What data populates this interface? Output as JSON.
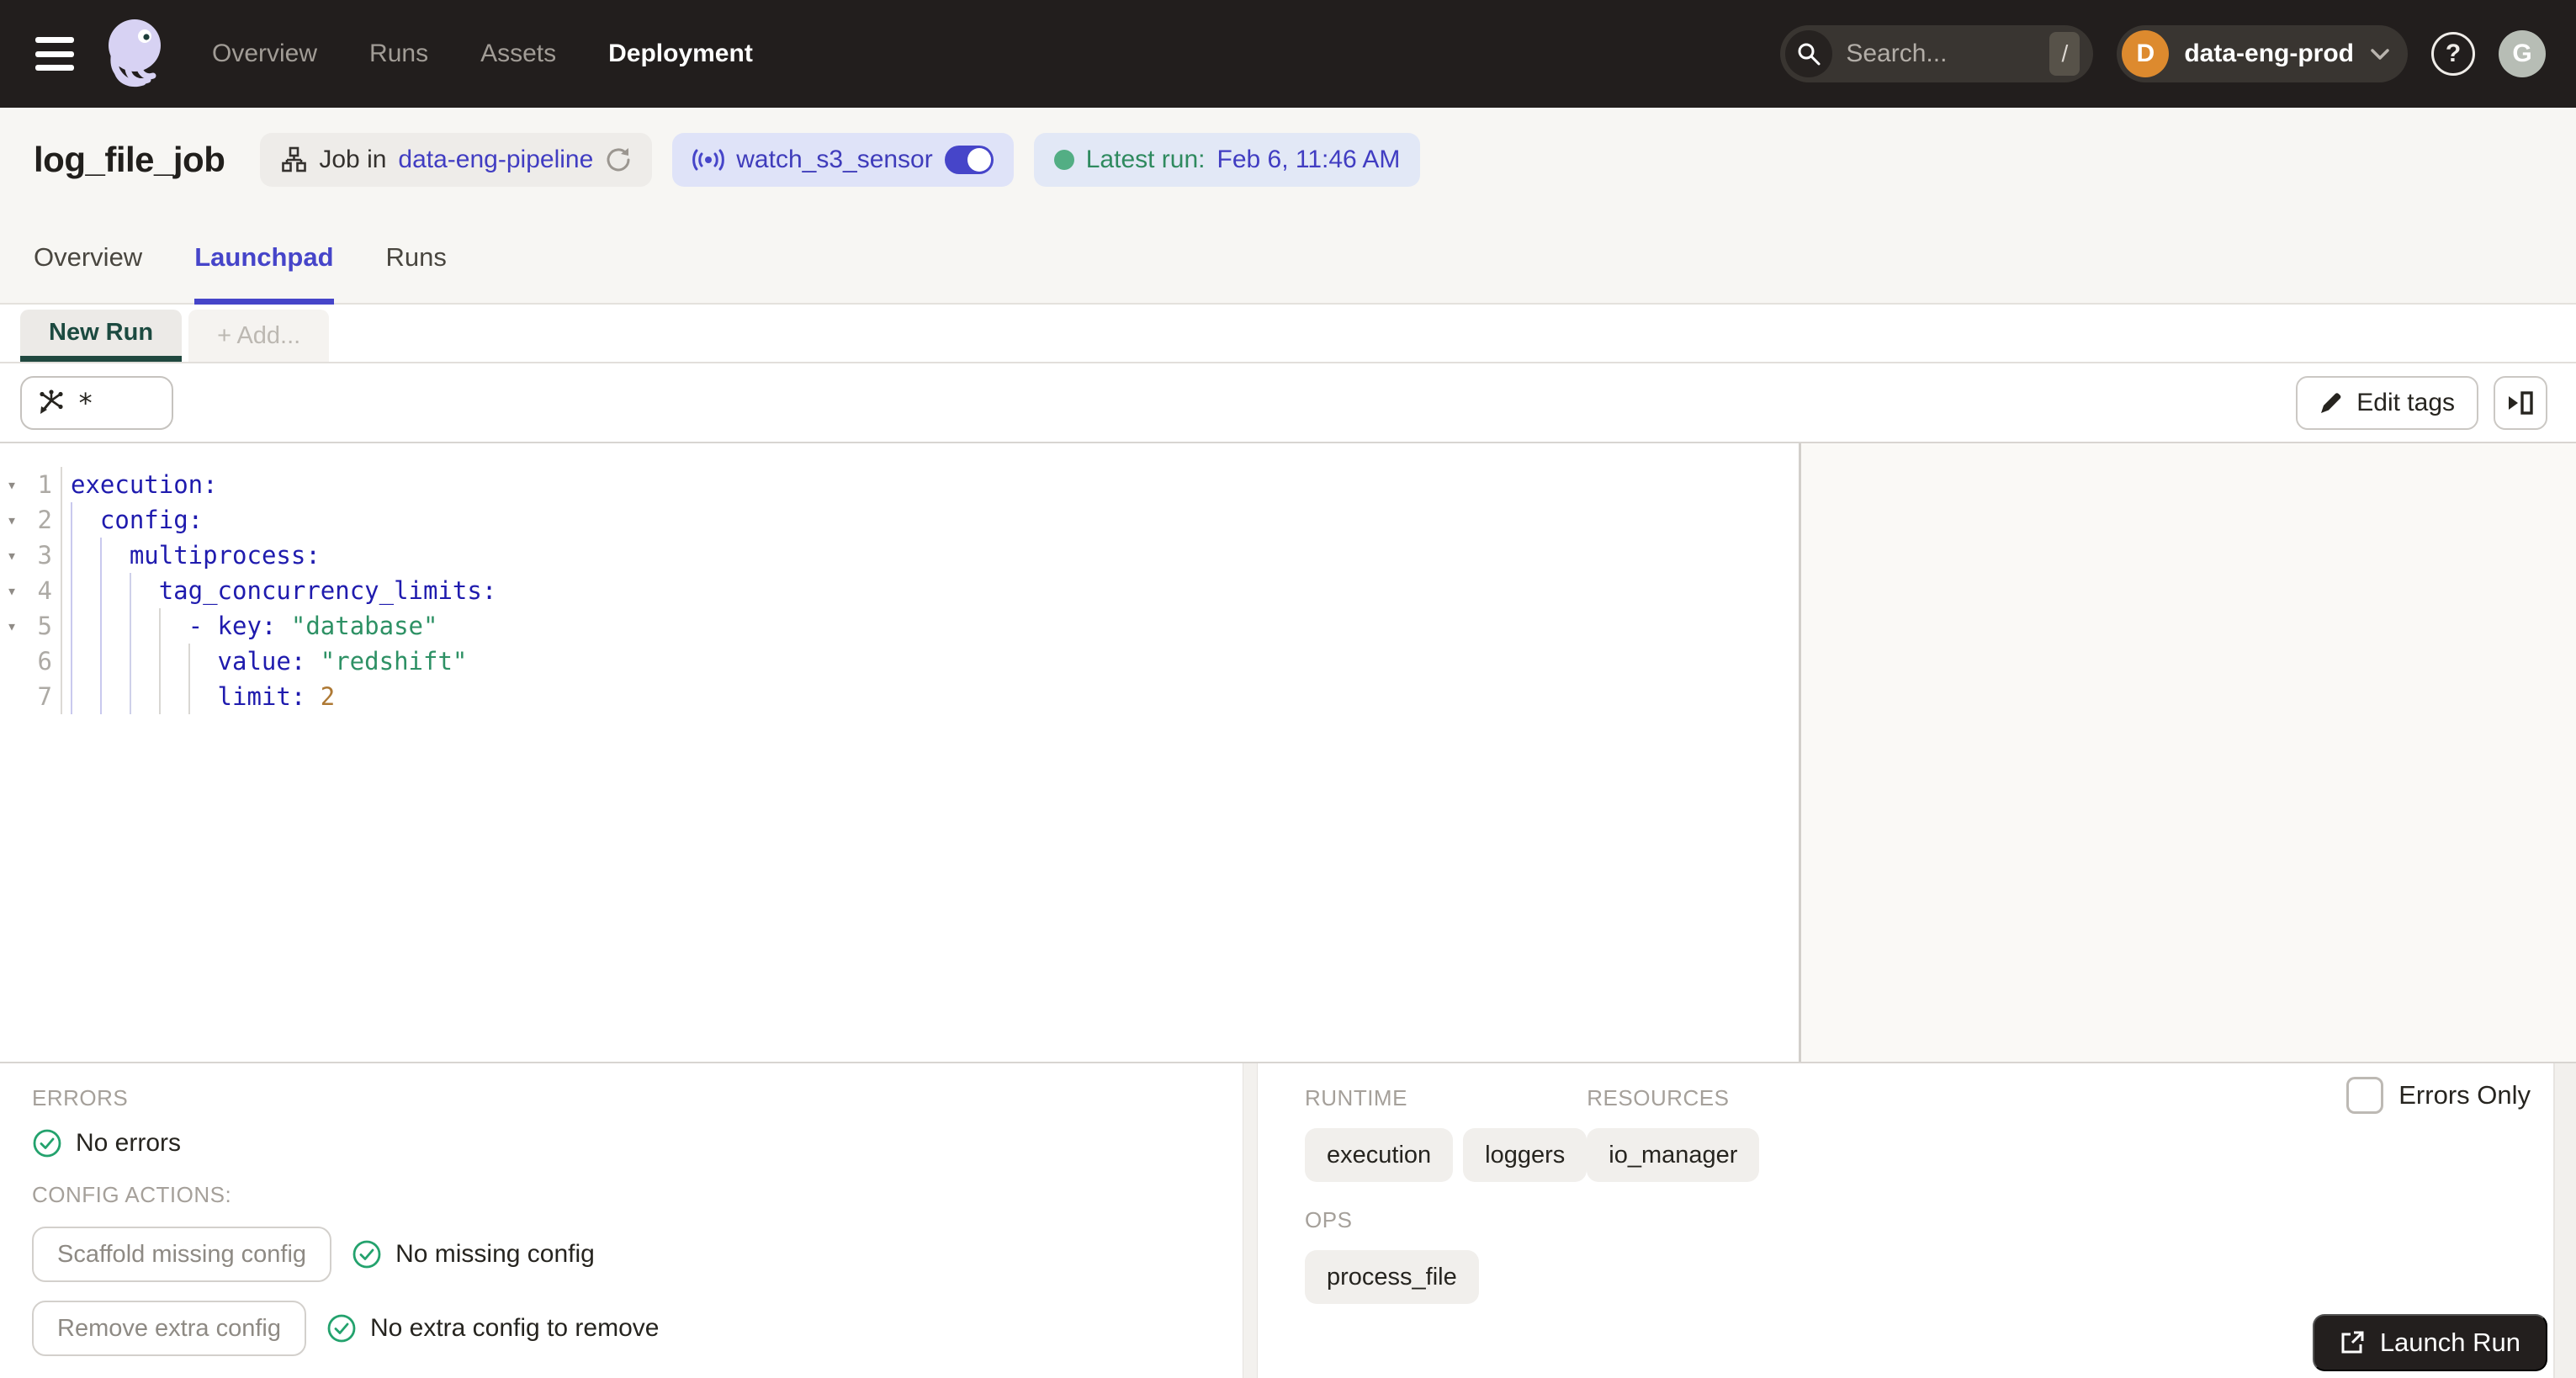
{
  "topnav": {
    "items": [
      "Overview",
      "Runs",
      "Assets",
      "Deployment"
    ],
    "active_item": "Deployment",
    "search": {
      "placeholder": "Search...",
      "shortcut_key": "/"
    },
    "deployment": {
      "initial": "D",
      "name": "data-eng-prod"
    },
    "help_glyph": "?",
    "user_initial": "G"
  },
  "header": {
    "title": "log_file_job",
    "job_badge": {
      "prefix": "Job in",
      "link": "data-eng-pipeline"
    },
    "sensor_badge": {
      "name": "watch_s3_sensor",
      "toggle_on": true
    },
    "latest_badge": {
      "label": "Latest run:",
      "value": "Feb 6, 11:46 AM"
    }
  },
  "tabs": {
    "items": [
      "Overview",
      "Launchpad",
      "Runs"
    ],
    "active": "Launchpad"
  },
  "launchpad": {
    "tabs": [
      "New Run",
      "+ Add..."
    ]
  },
  "toolbar": {
    "op_selection": "*",
    "edit_tags_label": "Edit tags"
  },
  "editor": {
    "language": "yaml",
    "lines": [
      {
        "num": 1,
        "fold": true,
        "indent": 0,
        "tokens": [
          {
            "t": "key",
            "v": "execution:"
          }
        ]
      },
      {
        "num": 2,
        "fold": true,
        "indent": 1,
        "tokens": [
          {
            "t": "key",
            "v": "config:"
          }
        ]
      },
      {
        "num": 3,
        "fold": true,
        "indent": 2,
        "tokens": [
          {
            "t": "key",
            "v": "multiprocess:"
          }
        ]
      },
      {
        "num": 4,
        "fold": true,
        "indent": 3,
        "tokens": [
          {
            "t": "key",
            "v": "tag_concurrency_limits:"
          }
        ]
      },
      {
        "num": 5,
        "fold": true,
        "indent": 4,
        "tokens": [
          {
            "t": "key",
            "v": "- key:"
          },
          {
            "t": "plain",
            "v": " "
          },
          {
            "t": "str",
            "v": "\"database\""
          }
        ]
      },
      {
        "num": 6,
        "fold": false,
        "indent": 5,
        "tokens": [
          {
            "t": "key",
            "v": "value:"
          },
          {
            "t": "plain",
            "v": " "
          },
          {
            "t": "str",
            "v": "\"redshift\""
          }
        ]
      },
      {
        "num": 7,
        "fold": false,
        "indent": 5,
        "tokens": [
          {
            "t": "key",
            "v": "limit:"
          },
          {
            "t": "plain",
            "v": " "
          },
          {
            "t": "num",
            "v": "2"
          }
        ]
      }
    ]
  },
  "bottom": {
    "errors_label": "ERRORS",
    "no_errors": "No errors",
    "config_actions_label": "CONFIG ACTIONS:",
    "scaffold_button": "Scaffold missing config",
    "no_missing": "No missing config",
    "remove_button": "Remove extra config",
    "no_extra": "No extra config to remove",
    "runtime_label": "RUNTIME",
    "runtime_tags": [
      "execution",
      "loggers"
    ],
    "resources_label": "RESOURCES",
    "resources_tags": [
      "io_manager"
    ],
    "ops_label": "OPS",
    "ops_tags": [
      "process_file"
    ],
    "errors_only_label": "Errors Only",
    "launch_label": "Launch Run"
  },
  "icons": {
    "menu": "hamburger",
    "logo": "dagster-octopus",
    "search": "magnifier",
    "chevron_down": "▾",
    "fold_arrow": "▾",
    "sensor": "broadcast",
    "job": "org-chart",
    "refresh": "circular-arrow",
    "pencil": "edit",
    "panel_toggle": "play-into-panel",
    "check": "circled-checkmark",
    "launch": "open-external"
  },
  "colors": {
    "accent_indigo": "#4645C9",
    "link_indigo": "#413DC2",
    "green": "#2F8A5F",
    "status_green": "#53AE84",
    "orange_avatar": "#DD8A2E",
    "dark_button": "#231F1E",
    "nav_bg": "#221E1D",
    "yaml_key": "#1F1BAE",
    "yaml_string": "#2E9165",
    "yaml_number": "#AE7934"
  }
}
